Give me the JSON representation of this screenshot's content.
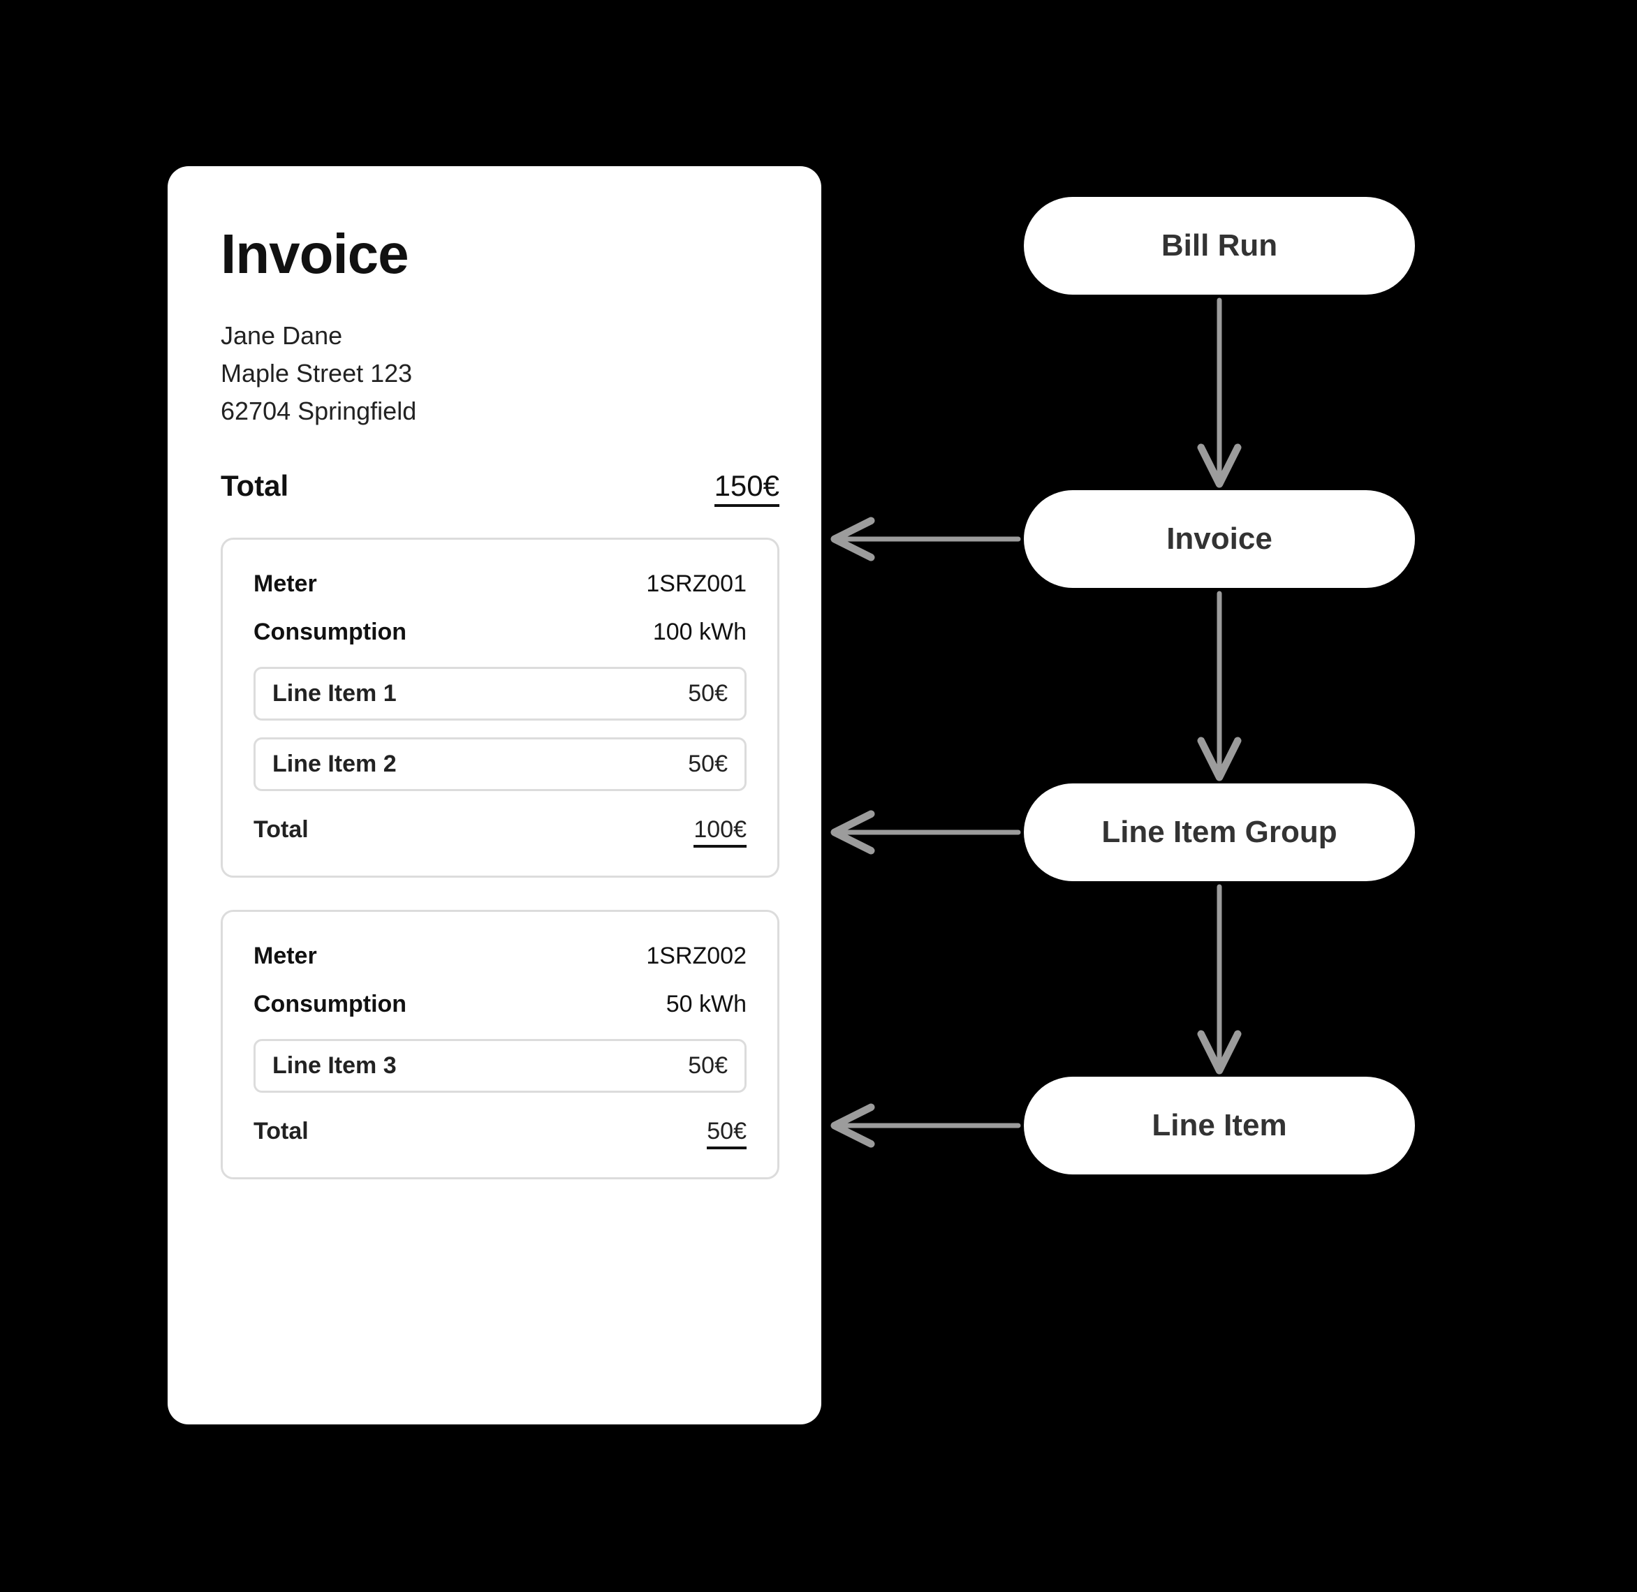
{
  "invoice": {
    "title": "Invoice",
    "customer_name": "Jane Dane",
    "street": "Maple Street 123",
    "city": "62704 Springfield",
    "total_label": "Total",
    "total_value": "150€",
    "groups": [
      {
        "meter_label": "Meter",
        "meter_value": "1SRZ001",
        "consumption_label": "Consumption",
        "consumption_value": "100 kWh",
        "line_items": [
          {
            "label": "Line Item 1",
            "value": "50€"
          },
          {
            "label": "Line Item 2",
            "value": "50€"
          }
        ],
        "total_label": "Total",
        "total_value": "100€"
      },
      {
        "meter_label": "Meter",
        "meter_value": "1SRZ002",
        "consumption_label": "Consumption",
        "consumption_value": "50 kWh",
        "line_items": [
          {
            "label": "Line Item 3",
            "value": "50€"
          }
        ],
        "total_label": "Total",
        "total_value": "50€"
      }
    ]
  },
  "flow": {
    "bill_run": "Bill Run",
    "invoice": "Invoice",
    "line_item_group": "Line Item Group",
    "line_item": "Line Item"
  }
}
